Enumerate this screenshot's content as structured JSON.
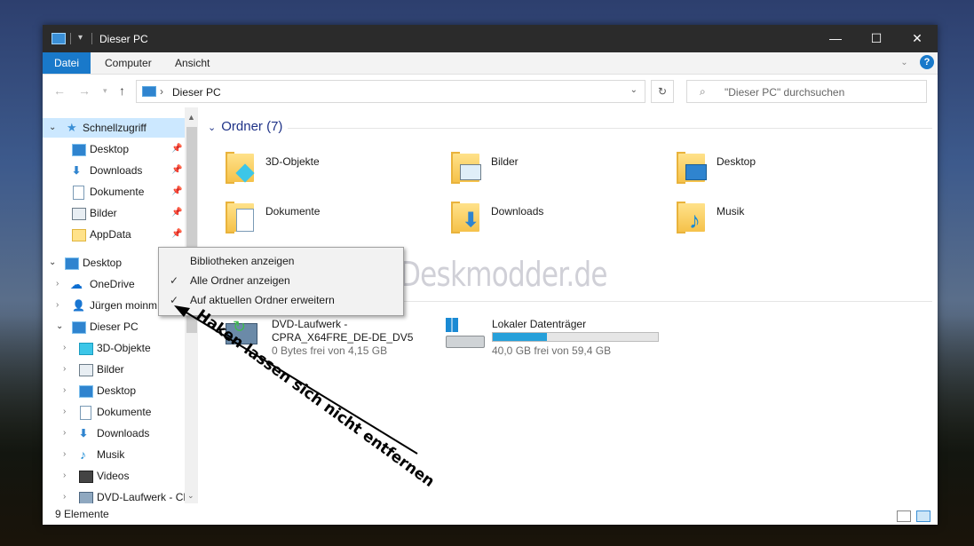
{
  "window": {
    "title": "Dieser PC",
    "controls": {
      "minimize": "—",
      "maximize": "☐",
      "close": "✕"
    }
  },
  "ribbon": {
    "tabs": [
      {
        "label": "Datei",
        "active": true
      },
      {
        "label": "Computer",
        "active": false
      },
      {
        "label": "Ansicht",
        "active": false
      }
    ],
    "help": "?"
  },
  "nav": {
    "address": "Dieser PC",
    "search_placeholder": "\"Dieser PC\" durchsuchen"
  },
  "sidebar": {
    "items": [
      {
        "label": "Schnellzugriff",
        "icon": "star-icon",
        "selected": true,
        "pinned": false
      },
      {
        "label": "Desktop",
        "icon": "desktop-icon",
        "pinned": true
      },
      {
        "label": "Downloads",
        "icon": "download-arrow-icon",
        "pinned": true
      },
      {
        "label": "Dokumente",
        "icon": "document-icon",
        "pinned": true
      },
      {
        "label": "Bilder",
        "icon": "pictures-icon",
        "pinned": true
      },
      {
        "label": "AppData",
        "icon": "folder-icon",
        "pinned": true
      },
      {
        "label": "Desktop",
        "icon": "desktop-icon"
      },
      {
        "label": "OneDrive",
        "icon": "cloud-icon"
      },
      {
        "label": "Jürgen moinm",
        "icon": "user-icon"
      },
      {
        "label": "Dieser PC",
        "icon": "computer-icon"
      },
      {
        "label": "3D-Objekte",
        "icon": "cube-icon"
      },
      {
        "label": "Bilder",
        "icon": "pictures-icon"
      },
      {
        "label": "Desktop",
        "icon": "desktop-icon"
      },
      {
        "label": "Dokumente",
        "icon": "document-icon"
      },
      {
        "label": "Downloads",
        "icon": "download-arrow-icon"
      },
      {
        "label": "Musik",
        "icon": "music-note-icon"
      },
      {
        "label": "Videos",
        "icon": "video-icon"
      },
      {
        "label": "DVD-Laufwerk - CPR",
        "icon": "dvd-icon"
      }
    ]
  },
  "groups": {
    "folders_header": "Ordner (7)",
    "folders": [
      {
        "name": "3D-Objekte",
        "overlay": "cube-icon"
      },
      {
        "name": "Bilder",
        "overlay": "pictures-icon"
      },
      {
        "name": "Desktop",
        "overlay": "desktop-icon"
      },
      {
        "name": "Dokumente",
        "overlay": "document-icon"
      },
      {
        "name": "Downloads",
        "overlay": "download-arrow-icon"
      },
      {
        "name": "Musik",
        "overlay": "music-note-icon"
      }
    ],
    "drives": [
      {
        "name_line1": "DVD-Laufwerk -",
        "name_line2": "CPRA_X64FRE_DE-DE_DV5",
        "free": "0 Bytes frei von 4,15 GB"
      },
      {
        "name_line1": "Lokaler Datenträger",
        "free": "40,0 GB frei von 59,4 GB",
        "used_fraction": 0.33
      }
    ]
  },
  "context_menu": {
    "items": [
      {
        "label": "Bibliotheken anzeigen",
        "checked": false
      },
      {
        "label": "Alle Ordner anzeigen",
        "checked": true
      },
      {
        "label": "Auf aktuellen Ordner erweitern",
        "checked": true
      }
    ]
  },
  "status": {
    "count": "9 Elemente"
  },
  "watermark": "Deskmodder.de",
  "annotation": "Haken lassen sich nicht entfernen",
  "colors": {
    "accent": "#1979ca",
    "selection": "#cce8ff",
    "group_header": "#1e3287",
    "progress": "#26a0da"
  }
}
